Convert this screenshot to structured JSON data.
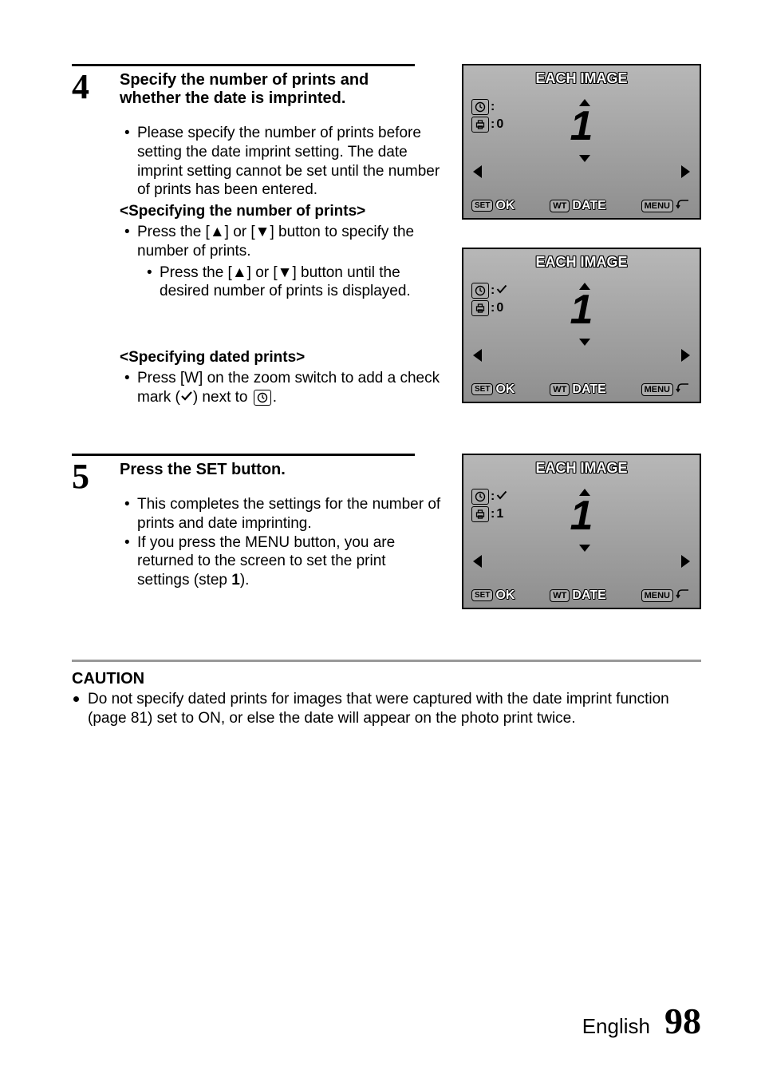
{
  "steps": {
    "s4": {
      "num": "4",
      "heading": "Specify the number of prints and whether the date is imprinted.",
      "b1": "Please specify the number of prints before setting the date imprint setting. The date imprint setting cannot be set until the number of prints has been entered.",
      "sub1": "<Specifying the number of prints>",
      "b2a": "Press the [",
      "b2b": "] or [",
      "b2c": "] button to specify the number of prints.",
      "b3a": "Press the [",
      "b3b": "] or [",
      "b3c": "] button until the desired number of prints is displayed.",
      "sub2": "<Specifying dated prints>",
      "b4a": "Press [W] on the zoom switch to add a check mark (",
      "b4b": ") next to ",
      "b4c": "."
    },
    "s5": {
      "num": "5",
      "heading": "Press the SET button.",
      "b1": "This completes the settings for the number of prints and date imprinting.",
      "b2a": "If you press the MENU button, you are returned to the screen to set the print settings (step ",
      "b2b": "1",
      "b2c": ")."
    }
  },
  "lcd": {
    "title": "EACH IMAGE",
    "big": "1",
    "ok": "OK",
    "date": "DATE",
    "menu": "MENU",
    "set": "SET",
    "wt": "WT",
    "screens": {
      "a": {
        "clock": "",
        "print": "0"
      },
      "b": {
        "clock": "✓",
        "print": "0"
      },
      "c": {
        "clock": "✓",
        "print": "1"
      }
    }
  },
  "caution": {
    "h": "CAUTION",
    "b1": "Do not specify dated prints for images that were captured with the date imprint function (page 81) set to ON, or else the date will appear on the photo print twice."
  },
  "footer": {
    "lang": "English",
    "page": "98"
  }
}
